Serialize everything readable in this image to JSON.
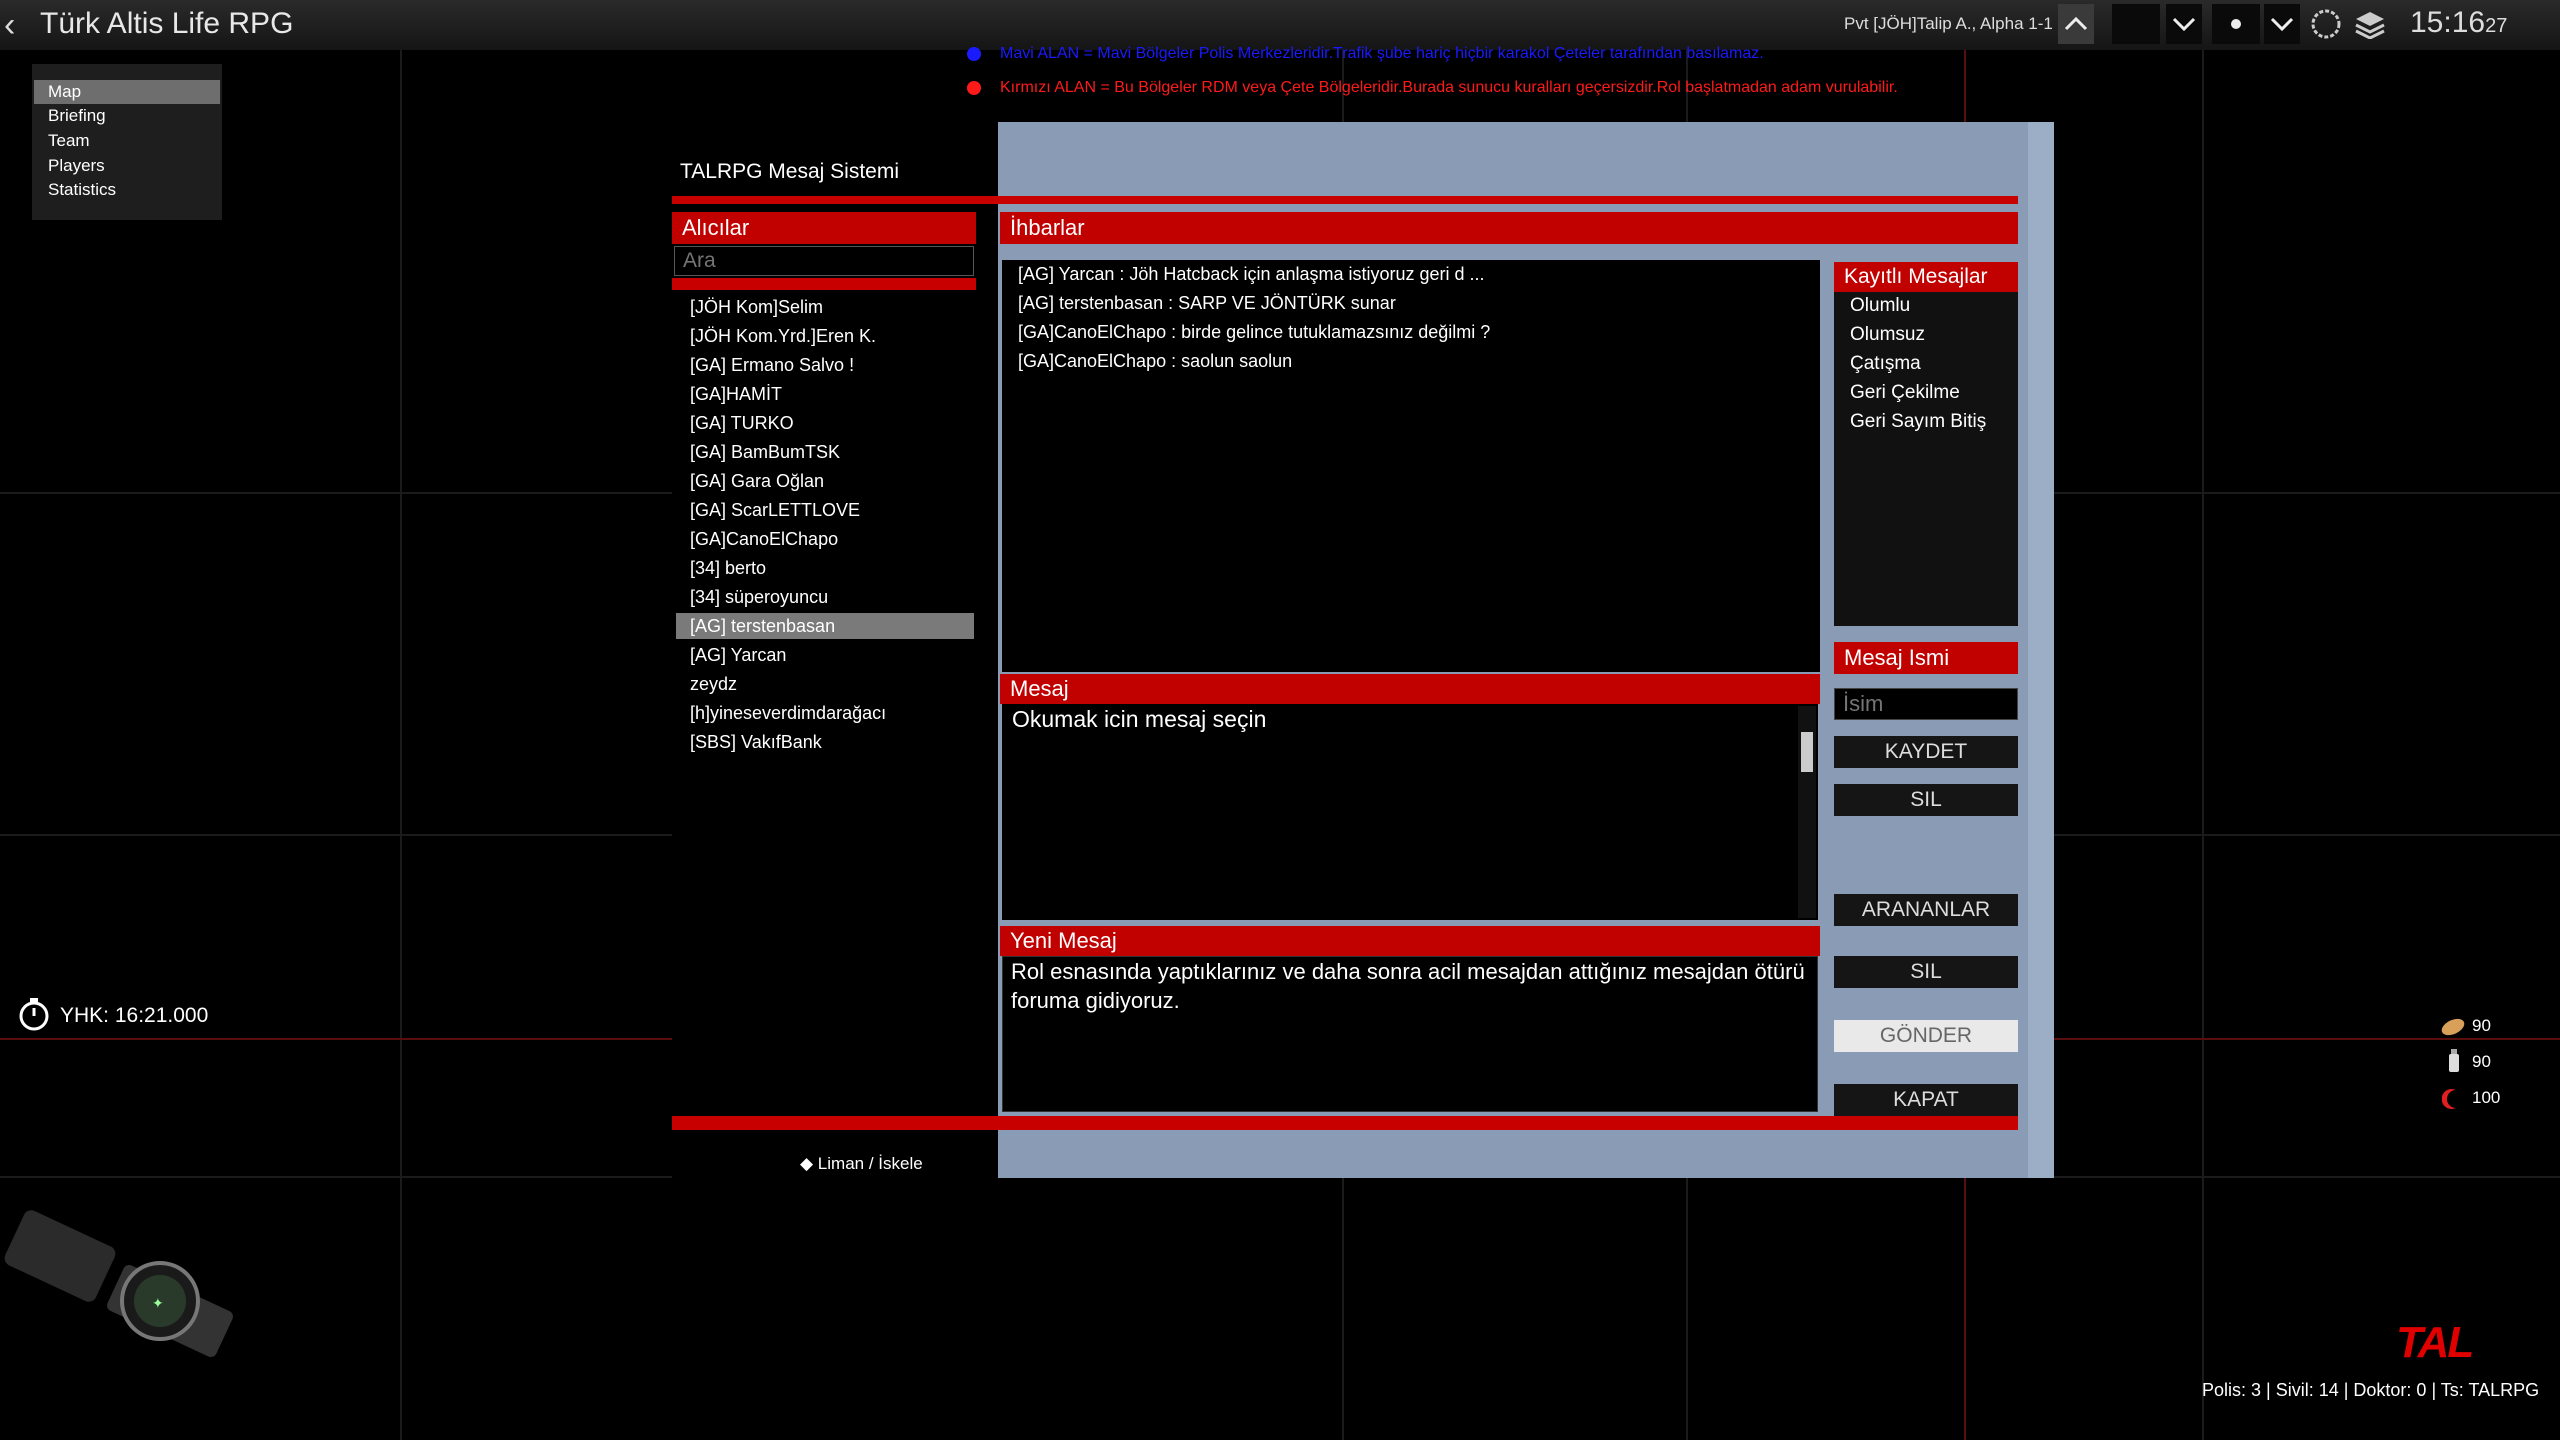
{
  "app": {
    "title": "Türk Altis Life RPG",
    "back_icon": "‹"
  },
  "topbar": {
    "player_info": "Pvt [JÖH]Talip A., Alpha 1-1 2",
    "clock_main": "15:16",
    "clock_seconds": "27"
  },
  "map_menu": {
    "items": [
      "Map",
      "Briefing",
      "Team",
      "Players",
      "Statistics"
    ]
  },
  "notices": [
    {
      "text": "Mavi ALAN = Mavi Bölgeler Polis Merkezleridir.Trafik şube hariç hiçbir karakol Çeteler tarafından basılamaz.",
      "color": "#1a1aff"
    },
    {
      "text": "Kırmızı ALAN = Bu Bölgeler RDM veya Çete Bölgeleridir.Burada sunucu kuralları geçersizdir.Rol başlatmadan adam vurulabilir.",
      "color": "#ff1a1a"
    }
  ],
  "dialog": {
    "title": "TALRPG Mesaj Sistemi",
    "recipients": {
      "header": "Alıcılar",
      "search_placeholder": "Ara",
      "items": [
        "[JÖH Kom]Selim",
        "[JÖH Kom.Yrd.]Eren K.",
        "[GA] Ermano Salvo !",
        "[GA]HAMİT",
        "[GA] TURKO",
        "[GA] BamBumTSK",
        "[GA] Gara Oğlan",
        "[GA] ScarLETTLOVE",
        "[GA]CanoElChapo",
        "[34] berto",
        "[34] süperoyuncu",
        "[AG] terstenbasan",
        "[AG] Yarcan",
        "zeydz",
        "[h]yineseverdimdarağacı",
        "[SBS] VakıfBank"
      ],
      "selected": "[AG] terstenbasan"
    },
    "reports": {
      "header": "İhbarlar",
      "messages": [
        "[AG] Yarcan : Jöh Hatcback için anlaşma istiyoruz geri d ...",
        "[AG] terstenbasan : SARP VE JÖNTÜRK  sunar",
        "[GA]CanoElChapo : birde gelince tutuklamazsınız değilmi ?",
        "[GA]CanoElChapo : saolun saolun"
      ]
    },
    "saved": {
      "header": "Kayıtlı Mesajlar",
      "items": [
        "Olumlu",
        "Olumsuz",
        "Çatışma",
        "Geri Çekilme",
        "Geri Sayım Bitiş"
      ]
    },
    "message": {
      "header": "Mesaj",
      "body": "Okumak icin mesaj seçin"
    },
    "message_name": {
      "header": "Mesaj Ismi",
      "placeholder": "İsim"
    },
    "new_message": {
      "header": "Yeni Mesaj",
      "body": "Rol esnasında yaptıklarınız ve daha sonra acil mesajdan attığınız mesajdan ötürü foruma gidiyoruz."
    },
    "buttons": {
      "save": "KAYDET",
      "delete1": "SIL",
      "called": "ARANANLAR",
      "delete2": "SIL",
      "send": "GÖNDER",
      "close": "KAPAT"
    }
  },
  "hud": {
    "timer": "YHK: 16:21.000",
    "location_label": "Liman / İskele",
    "food": "90",
    "water": "90",
    "health": "100",
    "logo": "TAL",
    "server_stats": "Polis: 3 | Sivil: 14 | Doktor: 0 | Ts: TALRPG"
  }
}
